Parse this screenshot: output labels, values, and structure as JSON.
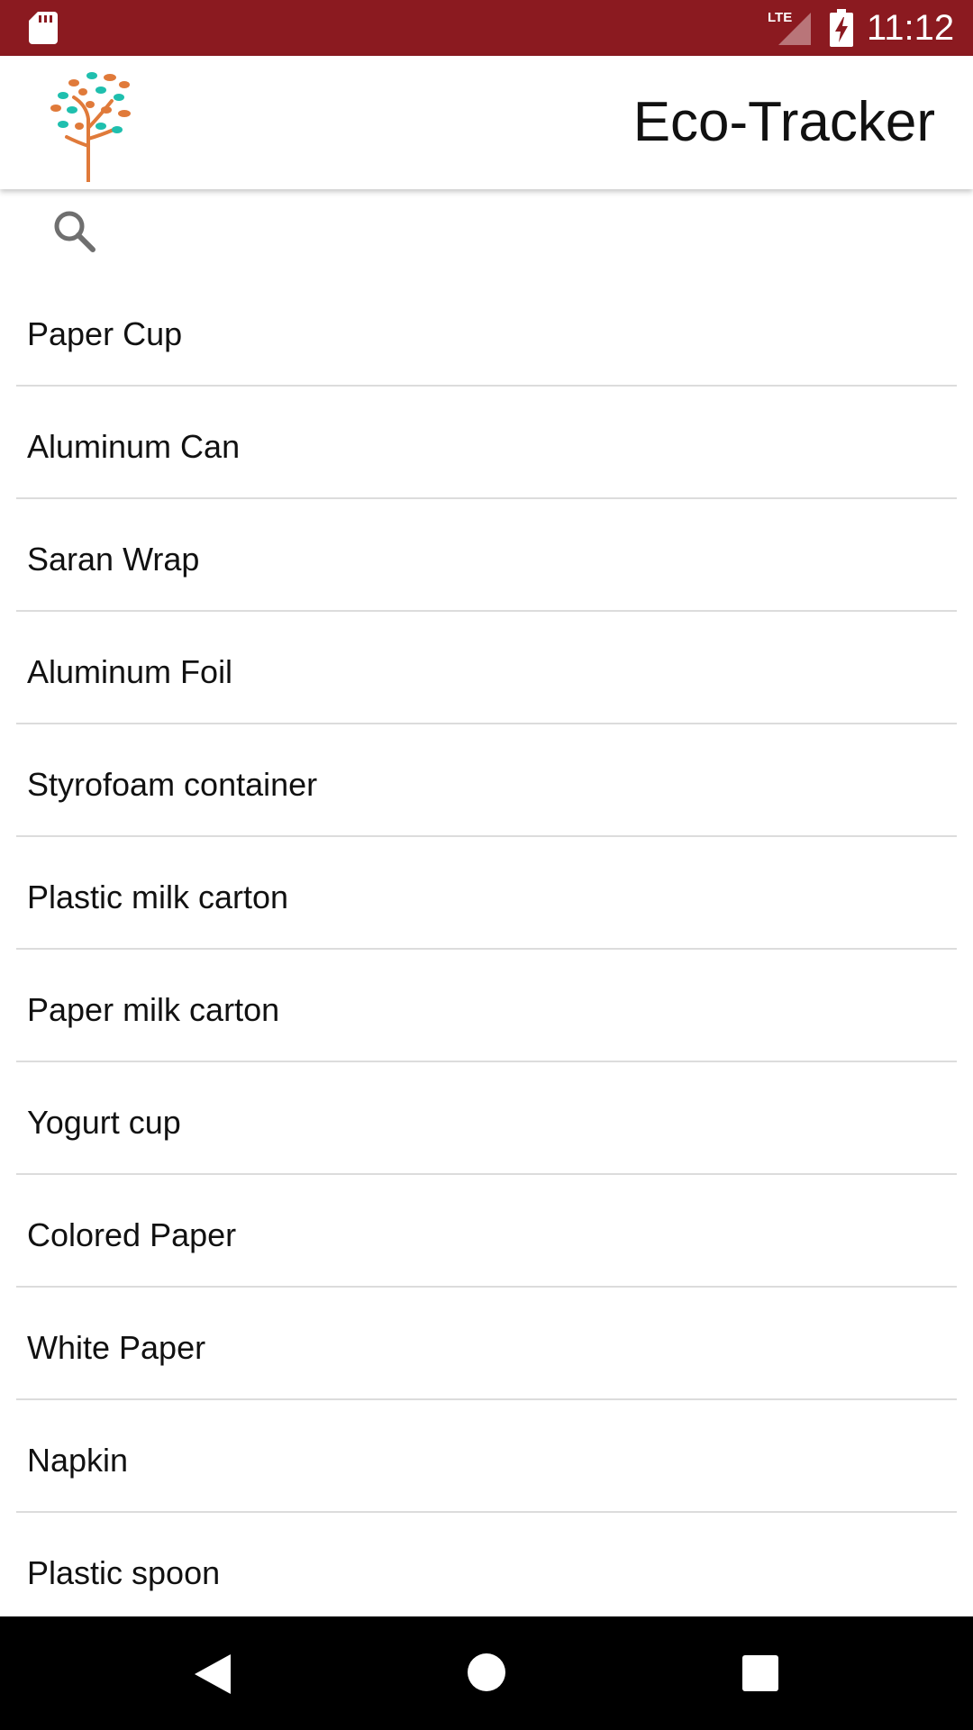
{
  "status_bar": {
    "time": "11:12",
    "network_label": "LTE",
    "icons": [
      "sd-card-icon",
      "lte-signal-icon",
      "battery-charging-icon"
    ],
    "background_color": "#8b1a20"
  },
  "app_bar": {
    "title": "Eco-Tracker",
    "logo_icon": "tree-logo-icon"
  },
  "search": {
    "icon": "search-icon",
    "value": "",
    "placeholder": ""
  },
  "items": [
    {
      "label": "Paper Cup"
    },
    {
      "label": "Aluminum Can"
    },
    {
      "label": "Saran Wrap"
    },
    {
      "label": "Aluminum Foil"
    },
    {
      "label": "Styrofoam container"
    },
    {
      "label": "Plastic milk carton"
    },
    {
      "label": "Paper milk carton"
    },
    {
      "label": "Yogurt cup"
    },
    {
      "label": "Colored Paper"
    },
    {
      "label": "White Paper"
    },
    {
      "label": "Napkin"
    },
    {
      "label": "Plastic spoon"
    }
  ],
  "nav_bar": {
    "icons": [
      "back-icon",
      "home-icon",
      "recent-apps-icon"
    ]
  }
}
